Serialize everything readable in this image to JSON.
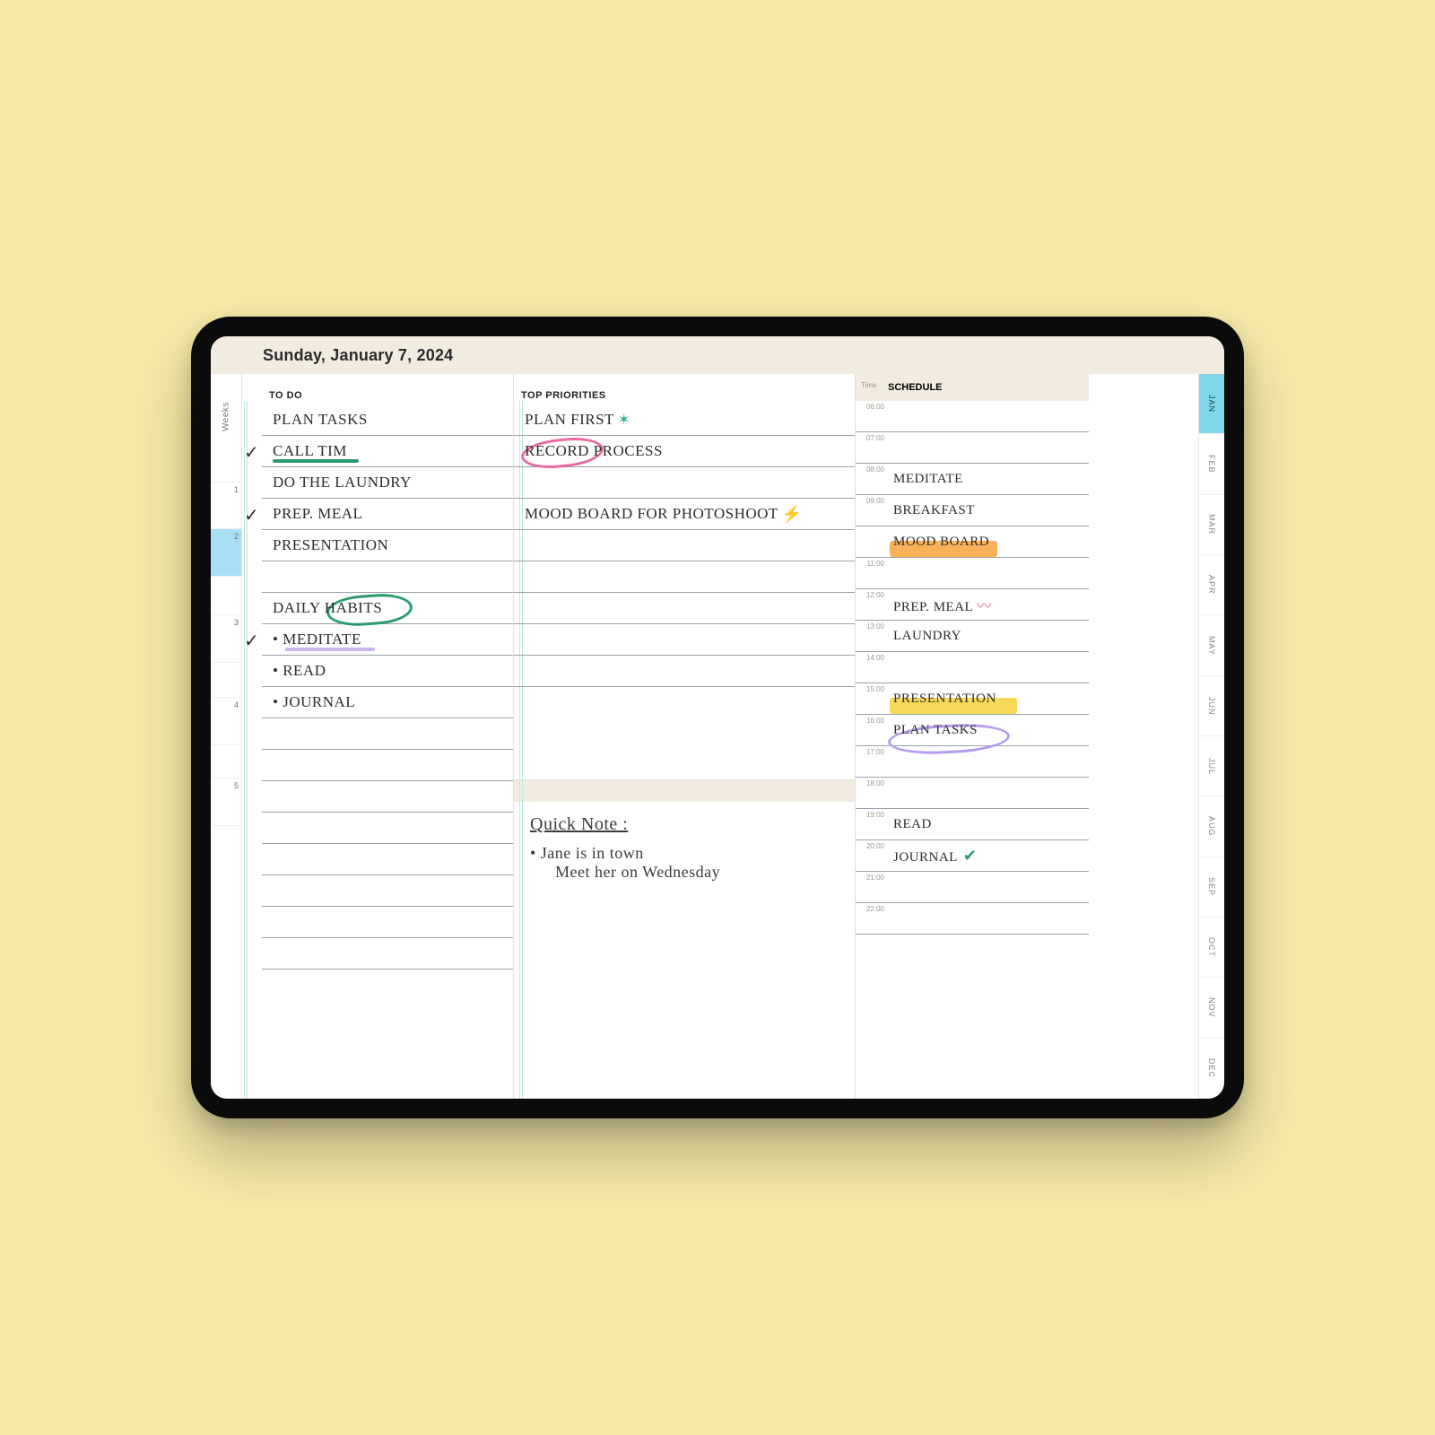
{
  "date_title": "Sunday, January 7, 2024",
  "weeks_label": "Weeks",
  "week_numbers": [
    "1",
    "2",
    "3",
    "4",
    "5"
  ],
  "active_week_index": 1,
  "months": [
    "JAN",
    "FEB",
    "MAR",
    "APR",
    "MAY",
    "JUN",
    "JUL",
    "AUG",
    "SEP",
    "OCT",
    "NOV",
    "DEC"
  ],
  "active_month_index": 0,
  "headers": {
    "todo": "TO DO",
    "priorities": "TOP PRIORITIES",
    "schedule": "SCHEDULE",
    "time": "Time"
  },
  "todo": [
    {
      "text": "PLAN  TASKS",
      "checked": false
    },
    {
      "text": "CALL TIM",
      "checked": true,
      "underline": "green"
    },
    {
      "text": "DO THE LAUNDRY",
      "checked": false
    },
    {
      "text": "PREP. MEAL",
      "checked": true
    },
    {
      "text": "PRESENTATION",
      "checked": false
    },
    {
      "text": "",
      "checked": false
    },
    {
      "text": "DAILY  HABITS",
      "checked": false,
      "circle": "green",
      "circle_word": "HABITS"
    },
    {
      "text": "MEDITATE",
      "checked": true,
      "bullet": true,
      "underline": "violet"
    },
    {
      "text": "READ",
      "checked": false,
      "bullet": true
    },
    {
      "text": "JOURNAL",
      "checked": false,
      "bullet": true
    }
  ],
  "priorities": [
    {
      "text": "PLAN FIRST",
      "suffix": "star"
    },
    {
      "text": "RECORD PROCESS",
      "circle": "pink",
      "circle_word": "RECORD"
    },
    {
      "text": ""
    },
    {
      "text": "MOOD BOARD FOR PHOTOSHOOT",
      "suffix": "bolt"
    }
  ],
  "quick_note": {
    "title": "Quick  Note :",
    "lines": [
      "• Jane is in town",
      "   Meet her on Wednesday"
    ]
  },
  "schedule": [
    {
      "time": "06:00",
      "text": ""
    },
    {
      "time": "07:00",
      "text": ""
    },
    {
      "time": "08:00",
      "text": "MEDITATE"
    },
    {
      "time": "09:00",
      "text": "BREAKFAST"
    },
    {
      "time": "",
      "text": "MOOD BOARD",
      "highlight": "orange"
    },
    {
      "time": "11:00",
      "text": ""
    },
    {
      "time": "12:00",
      "text": "PREP. MEAL",
      "suffix": "squig"
    },
    {
      "time": "13:00",
      "text": "LAUNDRY"
    },
    {
      "time": "14:00",
      "text": ""
    },
    {
      "time": "15:00",
      "text": "PRESENTATION",
      "highlight": "yellow"
    },
    {
      "time": "16:00",
      "text": "PLAN TASKS",
      "circle": "violet"
    },
    {
      "time": "17:00",
      "text": ""
    },
    {
      "time": "18:00",
      "text": ""
    },
    {
      "time": "19:00",
      "text": "READ"
    },
    {
      "time": "20:00",
      "text": "JOURNAL",
      "suffix": "tick-green"
    },
    {
      "time": "21:00",
      "text": ""
    },
    {
      "time": "22:00",
      "text": ""
    }
  ],
  "icons": {
    "check": "✓",
    "star": "✶",
    "bolt": "⚡",
    "squig": "〰",
    "tick": "✔",
    "bullet": "•"
  }
}
